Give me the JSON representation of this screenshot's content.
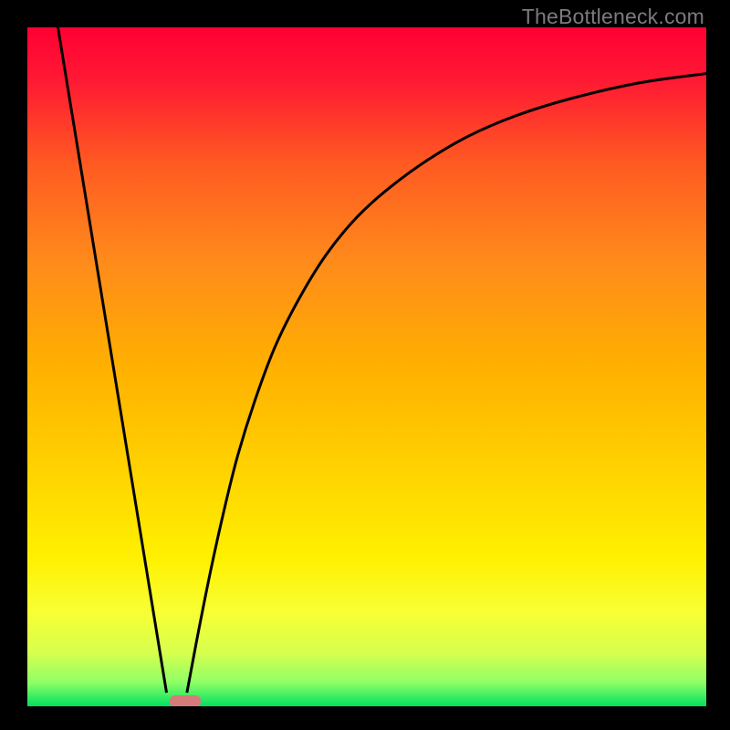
{
  "watermark": "TheBottleneck.com",
  "chart_data": {
    "type": "line",
    "title": "",
    "xlabel": "",
    "ylabel": "",
    "xlim": [
      0,
      100
    ],
    "ylim": [
      0,
      100
    ],
    "gradient_stops": [
      {
        "pos": 0.0,
        "color": "#ff0033"
      },
      {
        "pos": 0.08,
        "color": "#ff1a33"
      },
      {
        "pos": 0.2,
        "color": "#ff5a22"
      },
      {
        "pos": 0.35,
        "color": "#ff8c1a"
      },
      {
        "pos": 0.5,
        "color": "#ffb000"
      },
      {
        "pos": 0.65,
        "color": "#ffd200"
      },
      {
        "pos": 0.78,
        "color": "#fff000"
      },
      {
        "pos": 0.86,
        "color": "#f8ff33"
      },
      {
        "pos": 0.92,
        "color": "#d8ff4d"
      },
      {
        "pos": 0.965,
        "color": "#8fff66"
      },
      {
        "pos": 1.0,
        "color": "#00e060"
      }
    ],
    "series": [
      {
        "name": "left-descent",
        "x": [
          4.5,
          20.5
        ],
        "y": [
          100,
          2
        ]
      },
      {
        "name": "right-curve",
        "x": [
          23.5,
          25,
          27,
          29,
          31,
          33.5,
          36.5,
          40,
          44,
          48.5,
          53.5,
          59,
          65,
          72,
          80,
          90,
          100
        ],
        "y": [
          2,
          10,
          20,
          29,
          37,
          45,
          53,
          60,
          66.5,
          72,
          76.5,
          80.5,
          84,
          87,
          89.5,
          91.8,
          93.2
        ]
      }
    ],
    "marker": {
      "name": "bottleneck-point",
      "x_pct": 21.0,
      "y_pct": 98.4,
      "w_pct": 4.6,
      "h_pct": 1.7,
      "color": "#d77a7a"
    }
  }
}
